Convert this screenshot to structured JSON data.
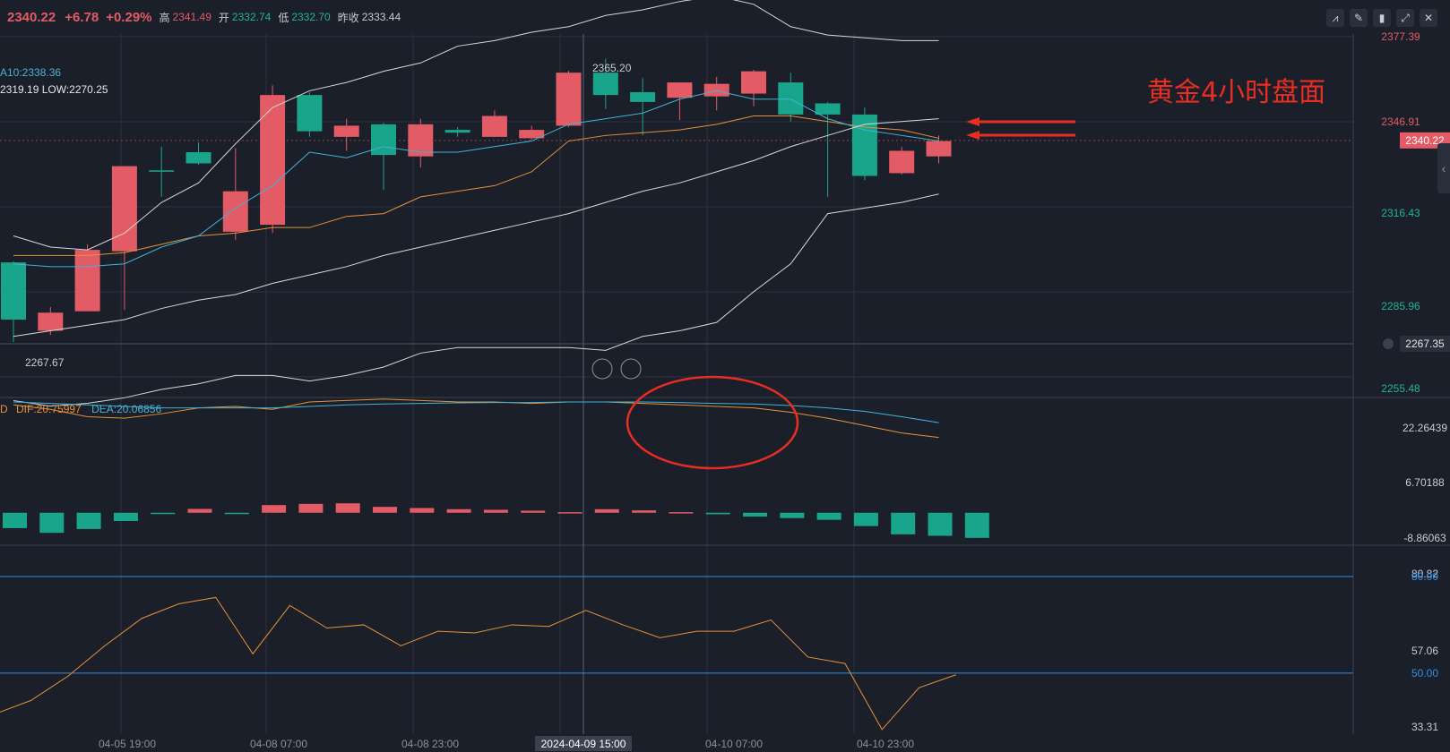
{
  "header": {
    "last_price": "2340.22",
    "change": "+6.78",
    "change_pct": "+0.29%",
    "high_label": "高",
    "high": "2341.49",
    "open_label": "开",
    "open": "2332.74",
    "low_label": "低",
    "low": "2332.70",
    "prev_close_label": "昨收",
    "prev_close": "2333.44"
  },
  "legends": {
    "ma10": "A10:2338.36",
    "high_low": "2319.19  LOW:2270.25",
    "macd_dif": "DIF:20.75997",
    "macd_dea": "DEA:20.06856",
    "macd_prefix": "D"
  },
  "annotation": {
    "title": "黄金4小时盘面"
  },
  "chart_data": {
    "type": "candlestick",
    "x_labels": [
      "04-05 19:00",
      "04-08 07:00",
      "04-08 23:00",
      "2024-04-09 15:00",
      "04-10 07:00",
      "04-10 23:00"
    ],
    "price_axis": {
      "ticks": [
        "2377.39",
        "2346.91",
        "2316.43",
        "2285.96",
        "2255.48"
      ],
      "current_price": "2340.22",
      "ref_price": "2267.35",
      "ylim": [
        2255.48,
        2377.39
      ]
    },
    "candle_labels": {
      "high": "2365.20",
      "low": "2267.67"
    },
    "candles": [
      {
        "o": 2296.5,
        "h": 2297.0,
        "l": 2268.0,
        "c": 2276.0
      },
      {
        "o": 2272.0,
        "h": 2280.5,
        "l": 2270.5,
        "c": 2278.5
      },
      {
        "o": 2279.0,
        "h": 2303.0,
        "l": 2279.0,
        "c": 2301.0
      },
      {
        "o": 2300.5,
        "h": 2329.0,
        "l": 2279.5,
        "c": 2331.0
      },
      {
        "o": 2329.5,
        "h": 2338.0,
        "l": 2320.0,
        "c": 2329.0
      },
      {
        "o": 2336.0,
        "h": 2339.5,
        "l": 2331.5,
        "c": 2332.0
      },
      {
        "o": 2307.5,
        "h": 2337.5,
        "l": 2304.5,
        "c": 2322.0
      },
      {
        "o": 2310.0,
        "h": 2360.0,
        "l": 2307.0,
        "c": 2356.5
      },
      {
        "o": 2356.5,
        "h": 2357.5,
        "l": 2341.5,
        "c": 2343.5
      },
      {
        "o": 2341.5,
        "h": 2348.0,
        "l": 2336.5,
        "c": 2345.5
      },
      {
        "o": 2346.0,
        "h": 2346.5,
        "l": 2322.5,
        "c": 2335.0
      },
      {
        "o": 2334.5,
        "h": 2348.0,
        "l": 2330.5,
        "c": 2346.0
      },
      {
        "o": 2344.0,
        "h": 2345.0,
        "l": 2341.5,
        "c": 2343.0
      },
      {
        "o": 2341.5,
        "h": 2351.0,
        "l": 2341.5,
        "c": 2349.0
      },
      {
        "o": 2341.0,
        "h": 2345.5,
        "l": 2340.5,
        "c": 2344.0
      },
      {
        "o": 2345.5,
        "h": 2365.2,
        "l": 2345.0,
        "c": 2364.5
      },
      {
        "o": 2364.5,
        "h": 2369.5,
        "l": 2351.5,
        "c": 2356.5
      },
      {
        "o": 2357.5,
        "h": 2362.5,
        "l": 2342.0,
        "c": 2354.0
      },
      {
        "o": 2355.5,
        "h": 2360.5,
        "l": 2347.5,
        "c": 2361.0
      },
      {
        "o": 2356.0,
        "h": 2363.0,
        "l": 2351.0,
        "c": 2360.5
      },
      {
        "o": 2357.0,
        "h": 2365.5,
        "l": 2352.5,
        "c": 2365.0
      },
      {
        "o": 2361.0,
        "h": 2364.5,
        "l": 2347.0,
        "c": 2349.5
      },
      {
        "o": 2353.5,
        "h": 2354.0,
        "l": 2320.0,
        "c": 2349.5
      },
      {
        "o": 2349.5,
        "h": 2352.0,
        "l": 2326.0,
        "c": 2327.5
      },
      {
        "o": 2328.5,
        "h": 2338.0,
        "l": 2328.0,
        "c": 2336.5
      },
      {
        "o": 2334.5,
        "h": 2342.0,
        "l": 2332.0,
        "c": 2340.0
      }
    ],
    "series": [
      {
        "values": [
          2299,
          2299,
          2299,
          2300,
          2303,
          2306,
          2307,
          2309,
          2309,
          2313,
          2314,
          2320,
          2322,
          2324,
          2329,
          2340,
          2342,
          2343,
          2344,
          2346,
          2349,
          2349,
          2347,
          2345,
          2344,
          2341
        ]
      },
      {
        "values": [
          2296,
          2295,
          2295,
          2296,
          2302,
          2306,
          2316,
          2324,
          2336,
          2334,
          2338,
          2336,
          2336,
          2338,
          2340,
          2346,
          2348,
          2350,
          2355,
          2358,
          2355,
          2355,
          2348,
          2344,
          2342,
          2340
        ]
      },
      {
        "values": [
          2270,
          2272,
          2274,
          2276,
          2280,
          2283,
          2285,
          2289,
          2292,
          2295,
          2299,
          2302,
          2305,
          2308,
          2311,
          2314,
          2318,
          2322,
          2325,
          2329,
          2333,
          2338,
          2342,
          2346,
          2347,
          2348
        ]
      },
      {
        "values": [
          2306,
          2302,
          2301,
          2307,
          2318,
          2325,
          2339,
          2352,
          2358,
          2361,
          2365,
          2368,
          2374,
          2376,
          2379,
          2381,
          2385,
          2387,
          2390,
          2392,
          2389,
          2381,
          2378,
          2377,
          2376,
          2376
        ]
      },
      {
        "values": [
          2247,
          2245,
          2246,
          2248,
          2251,
          2253,
          2256,
          2256,
          2254,
          2256,
          2259,
          2264,
          2266,
          2266,
          2266,
          2266,
          2265,
          2270,
          2272,
          2275,
          2286,
          2296,
          2314,
          2316,
          2318,
          2321
        ]
      }
    ],
    "macd": {
      "axis_ticks": [
        "22.26439",
        "6.70188",
        "-8.86063"
      ],
      "ylim": [
        -8.86063,
        37.8
      ]
    },
    "rsi": {
      "axis_ticks": [
        "80.82",
        "57.06",
        "33.31"
      ],
      "lines": [
        "80.00",
        "50.00"
      ],
      "ylim": [
        33.31,
        80.82
      ],
      "values": [
        37.2,
        41.5,
        49.0,
        58.5,
        67.0,
        71.5,
        73.5,
        56.0,
        71.0,
        64.0,
        65.0,
        58.5,
        63.0,
        62.5,
        65.0,
        64.5,
        69.5,
        65.0,
        61.0,
        63.0,
        63.0,
        66.5,
        55.0,
        53.0,
        32.5,
        45.5,
        49.5
      ]
    }
  }
}
